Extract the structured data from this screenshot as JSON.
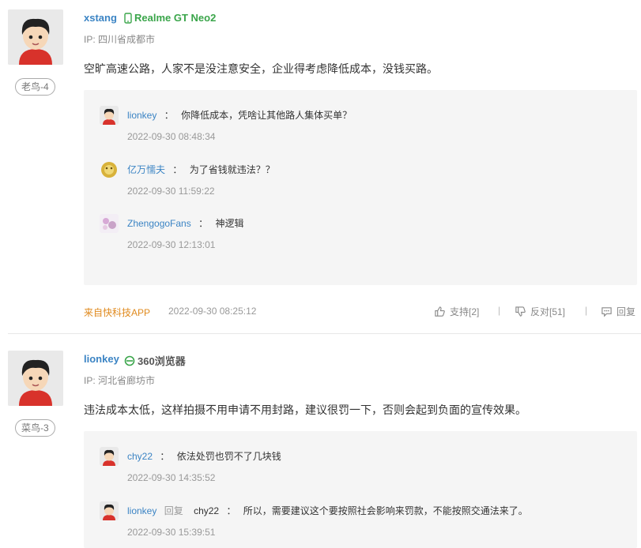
{
  "comments": [
    {
      "username": "xstang",
      "device": "Realme GT Neo2",
      "ip": "IP: 四川省成都市",
      "rank": "老鸟-4",
      "content": "空旷高速公路，人家不是没注意安全，企业得考虑降低成本，没钱买路。",
      "replies": [
        {
          "name": "lionkey",
          "sep": "：",
          "text": "你降低成本，凭啥让其他路人集体买单？",
          "time": "2022-09-30 08:48:34"
        },
        {
          "name": "亿万懦夫",
          "sep": "：",
          "text": "为了省钱就违法？？",
          "time": "2022-09-30 11:59:22"
        },
        {
          "name": "ZhengogoFans",
          "sep": "：",
          "text": "神逻辑",
          "time": "2022-09-30 12:13:01"
        }
      ],
      "source": "来自快科技APP",
      "datetime": "2022-09-30 08:25:12",
      "support": "支持[2]",
      "oppose": "反对[51]",
      "reply": "回复",
      "divider": "|"
    },
    {
      "username": "lionkey",
      "device": "360浏览器",
      "ip": "IP: 河北省廊坊市",
      "rank": "菜鸟-3",
      "content": "违法成本太低，这样拍摄不用申请不用封路，建议很罚一下，否则会起到负面的宣传效果。",
      "replies": [
        {
          "name": "chy22",
          "sep": "：",
          "text": "依法处罚也罚不了几块钱",
          "time": "2022-09-30 14:35:52"
        },
        {
          "name": "lionkey",
          "reply_word": "回复",
          "target": "chy22",
          "sep": "：",
          "text": "所以，需要建议这个要按照社会影响来罚款，不能按照交通法来了。",
          "time": "2022-09-30 15:39:51"
        }
      ]
    }
  ],
  "colors": {
    "link": "#3b84c4",
    "device_green": "#3aa54a",
    "source_orange": "#e08a1e"
  }
}
